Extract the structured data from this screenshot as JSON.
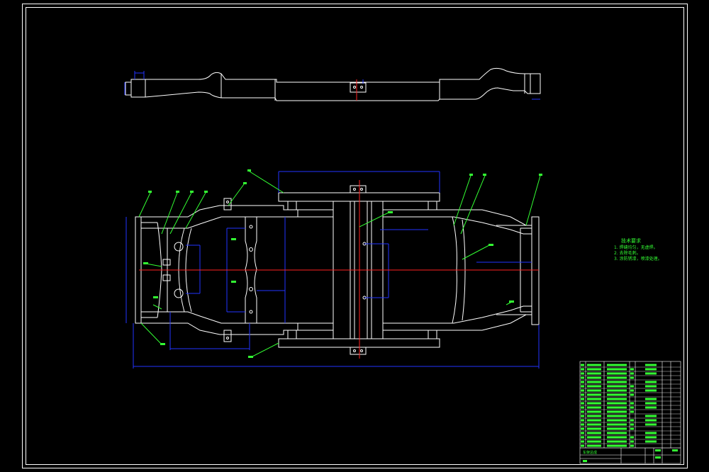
{
  "drawing": {
    "background": "#000000",
    "colors": {
      "outline": "#ffffff",
      "dimension": "#2233ff",
      "centerline": "#ff2222",
      "leader": "#33ff33",
      "table": "#33ff33"
    }
  },
  "tech_notes": {
    "title": "技术要求",
    "items": [
      "1. 焊缝均匀，无虚焊。",
      "2. 去除毛刺。",
      "3. 涂防锈漆，喷漆处理。"
    ]
  },
  "title_block": {
    "name": "车架总成"
  }
}
